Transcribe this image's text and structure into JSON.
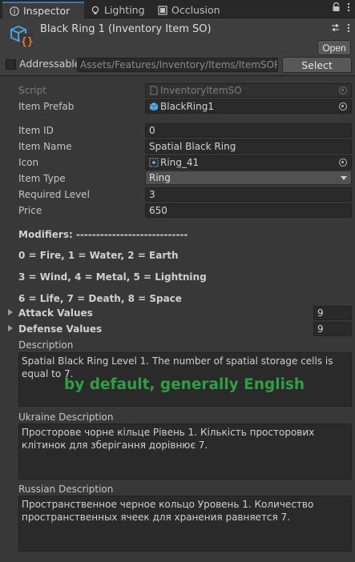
{
  "tabs": [
    {
      "label": "Inspector",
      "icon": "info-icon",
      "active": true
    },
    {
      "label": "Lighting",
      "icon": "bulb-icon",
      "active": false
    },
    {
      "label": "Occlusion",
      "icon": "occlusion-icon",
      "active": false
    }
  ],
  "header": {
    "title": "Black Ring 1 (Inventory Item SO)",
    "open_label": "Open",
    "addressable_label": "Addressable",
    "addressable_checked": false,
    "address_path": "Assets/Features/Inventory/Items/ItemSORing",
    "select_label": "Select"
  },
  "fields": {
    "script": {
      "label": "Script",
      "value": "InventoryItemSO"
    },
    "item_prefab": {
      "label": "Item Prefab",
      "value": "BlackRing1"
    },
    "item_id": {
      "label": "Item ID",
      "value": "0"
    },
    "item_name": {
      "label": "Item Name",
      "value": "Spatial Black Ring"
    },
    "icon": {
      "label": "Icon",
      "value": "Ring_41"
    },
    "item_type": {
      "label": "Item Type",
      "value": "Ring"
    },
    "required_level": {
      "label": "Required Level",
      "value": "3"
    },
    "price": {
      "label": "Price",
      "value": "650"
    }
  },
  "modifiers": {
    "heading": "Modifiers: ----------------------------",
    "line1": "0 = Fire, 1 = Water, 2 = Earth",
    "line2": "3 = Wind, 4 = Metal, 5 = Lightning",
    "line3": "6 = Life, 7 = Death, 8 = Space"
  },
  "arrays": {
    "attack": {
      "label": "Attack Values",
      "count": "9"
    },
    "defense": {
      "label": "Defense Values",
      "count": "9"
    }
  },
  "descriptions": {
    "default": {
      "label": "Description",
      "text": "Spatial Black Ring Level 1. The number of spatial storage cells is equal to 7."
    },
    "note": "by default, generally English",
    "ukraine": {
      "label": "Ukraine Description",
      "text": "Просторове чорне кільце Рівень 1. Кількість просторових клітинок для зберігання дорівнює 7."
    },
    "russian": {
      "label": "Russian Description",
      "text": "Пространственное черное кольцо Уровень 1. Количество пространственных ячеек для хранения равняется 7."
    }
  },
  "colors": {
    "accent": "#3a79bb",
    "note_green": "#2ea043",
    "so_icon_blue": "#4aa3d8",
    "so_icon_orange": "#e8782b"
  }
}
